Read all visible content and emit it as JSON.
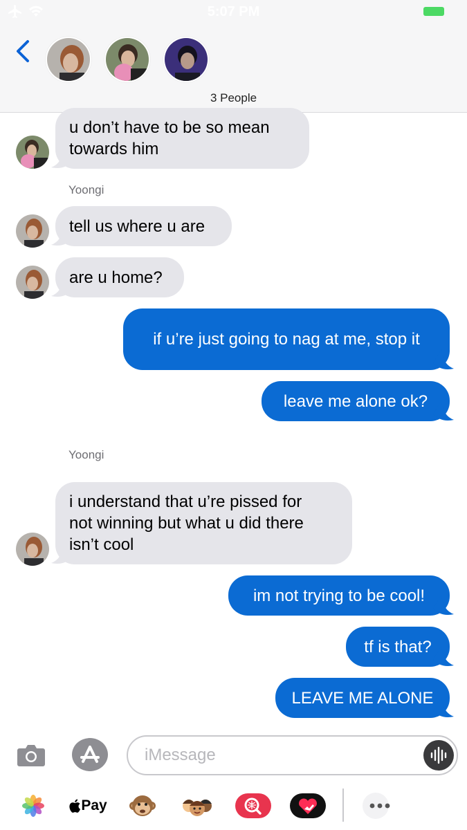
{
  "status_bar": {
    "time": "5:07 PM"
  },
  "header": {
    "subtitle": "3 People",
    "participants": [
      "avatar-1",
      "avatar-2",
      "avatar-3"
    ]
  },
  "messages": [
    {
      "direction": "in",
      "text": "u don’t have to be so mean\ntowards him"
    },
    {
      "sender": "Yoongi"
    },
    {
      "direction": "in",
      "text": "tell us where u are"
    },
    {
      "direction": "in",
      "text": "are u home?"
    },
    {
      "direction": "out",
      "text": "if u’re just going to nag at me, stop it"
    },
    {
      "direction": "out",
      "text": "leave me alone ok?"
    },
    {
      "sender": "Yoongi"
    },
    {
      "direction": "in",
      "text": "i understand that u’re pissed for\nnot winning but what u did there\nisn’t cool"
    },
    {
      "direction": "out",
      "text": "im not trying to be cool!"
    },
    {
      "direction": "out",
      "text": "tf is that?"
    },
    {
      "direction": "out",
      "text": "LEAVE ME ALONE"
    }
  ],
  "input": {
    "placeholder": "iMessage"
  },
  "drawer": {
    "applepay_label": "Pay"
  },
  "colors": {
    "incoming": "#e5e5ea",
    "outgoing": "#0b6bd3",
    "accent": "#0b62d6"
  }
}
